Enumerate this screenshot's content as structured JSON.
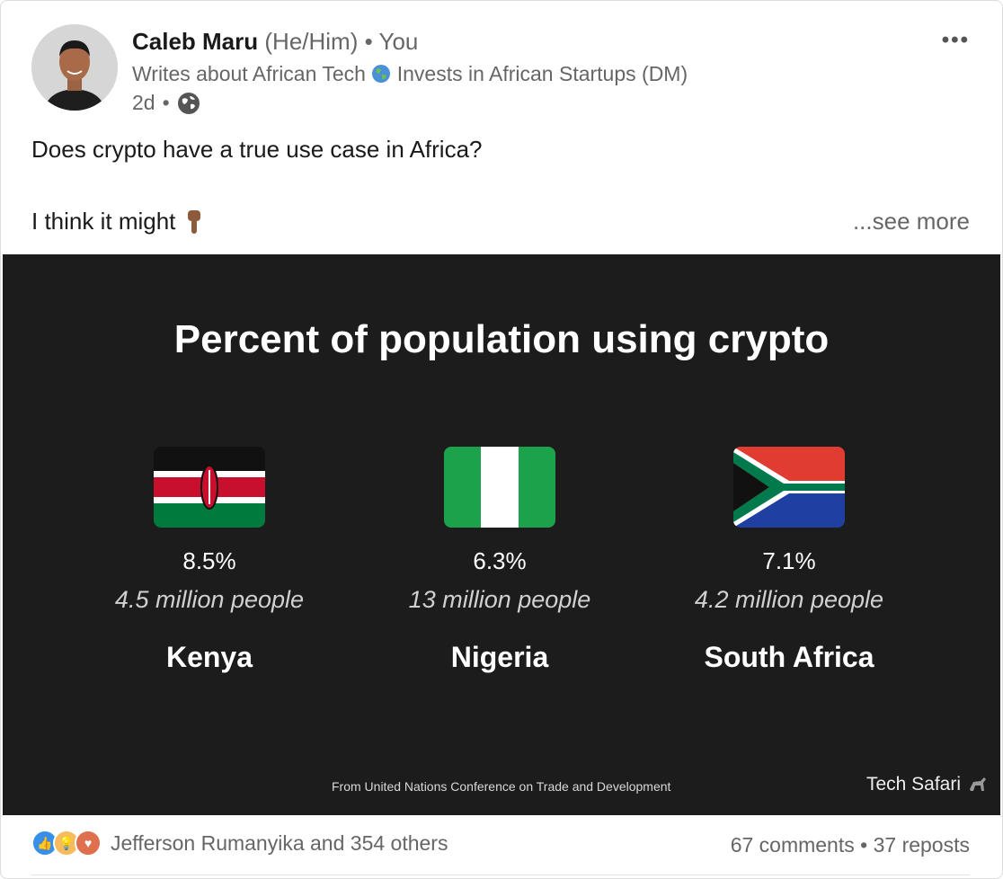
{
  "author": {
    "name": "Caleb Maru",
    "pronouns": "(He/Him)",
    "separator": "•",
    "relation": "You",
    "headline_part1": "Writes about African Tech",
    "headline_part2": "Invests in African Startups (DM)",
    "time": "2d",
    "time_separator": "•"
  },
  "post": {
    "line1": "Does crypto have a true use case in Africa?",
    "line2": "I think it might",
    "emoji": "👇🏾",
    "see_more": "...see more"
  },
  "media": {
    "title": "Percent of population using crypto",
    "countries": [
      {
        "name": "Kenya",
        "percent": "8.5%",
        "people": "4.5 million people"
      },
      {
        "name": "Nigeria",
        "percent": "6.3%",
        "people": "13 million people"
      },
      {
        "name": "South Africa",
        "percent": "7.1%",
        "people": "4.2 million people"
      }
    ],
    "source": "From United Nations Conference on Trade and Development",
    "brand": "Tech Safari"
  },
  "social": {
    "reactors": "Jefferson Rumanyika and 354 others",
    "comments": "67 comments",
    "separator": "•",
    "reposts": "37 reposts"
  },
  "icons": {
    "more": "more-options-icon",
    "globe": "globe-icon",
    "like": "like-reaction-icon",
    "insightful": "insightful-reaction-icon",
    "love": "love-reaction-icon"
  },
  "colors": {
    "like": "#378fe9",
    "insightful": "#f5bb5c",
    "love": "#df704d",
    "media_bg": "#1c1c1c"
  }
}
